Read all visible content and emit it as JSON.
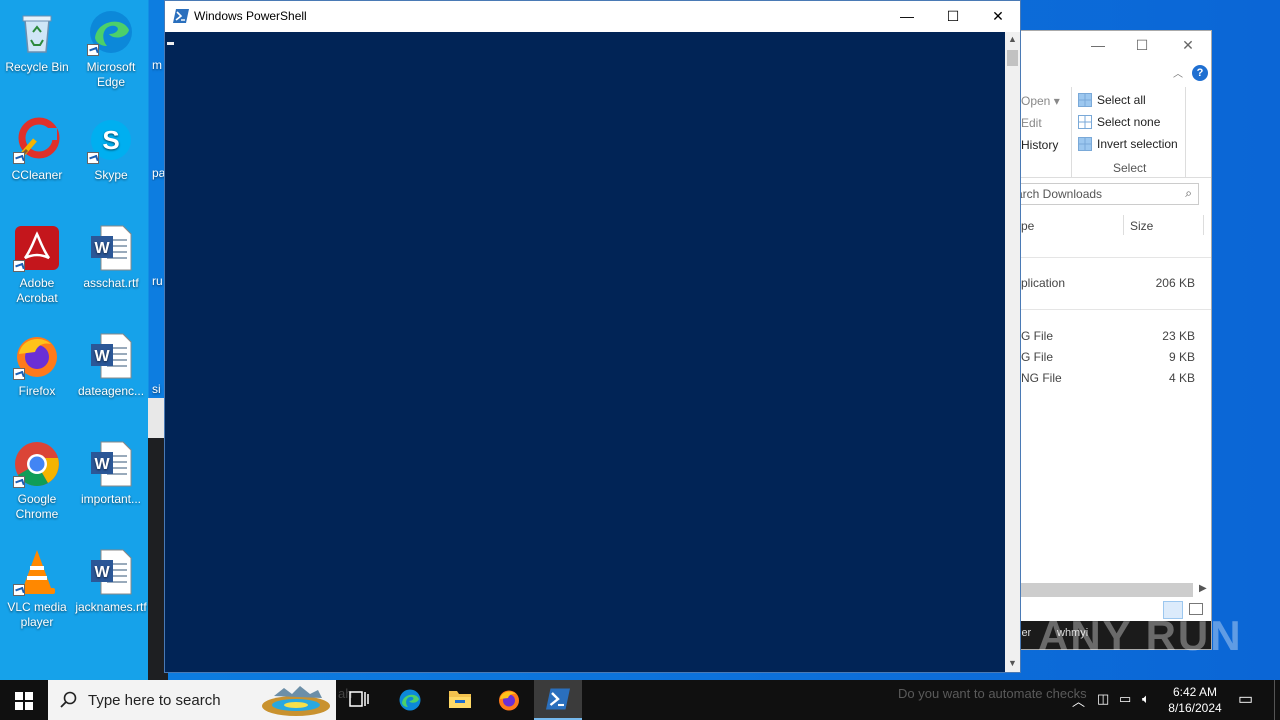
{
  "desktop": {
    "icons": [
      {
        "label": "Recycle Bin"
      },
      {
        "label": "Microsoft Edge"
      },
      {
        "label": "CCleaner"
      },
      {
        "label": "Skype"
      },
      {
        "label": "Adobe Acrobat"
      },
      {
        "label": "asschat.rtf"
      },
      {
        "label": "Firefox"
      },
      {
        "label": "dateagenc..."
      },
      {
        "label": "Google Chrome"
      },
      {
        "label": "important..."
      },
      {
        "label": "VLC media player"
      },
      {
        "label": "jacknames.rtf"
      }
    ],
    "partial_labels": [
      "m",
      "pa",
      "ru",
      "si"
    ]
  },
  "explorer": {
    "controls": {
      "minimize": "—",
      "maximize": "☐",
      "close": "✕"
    },
    "ribbon": {
      "open": "Open",
      "edit": "Edit",
      "history": "History",
      "select_all": "Select all",
      "select_none": "Select none",
      "invert_selection": "Invert selection",
      "group_label": "Select"
    },
    "search_placeholder": "arch Downloads",
    "columns": {
      "type": "pe",
      "size": "Size"
    },
    "files": [
      {
        "type": "plication",
        "size": "206 KB"
      },
      {
        "type": "G File",
        "size": "23 KB"
      },
      {
        "type": "G File",
        "size": "9 KB"
      },
      {
        "type": "NG File",
        "size": "4 KB"
      }
    ],
    "status_fragments": [
      "ler",
      "whmyi"
    ]
  },
  "powershell": {
    "title": "Windows PowerShell",
    "controls": {
      "minimize": "—",
      "maximize": "☐",
      "close": "✕"
    }
  },
  "watermark": "ANY RUN",
  "taskbar": {
    "search_placeholder": "Type here to search",
    "background_text": "Do you want to automate checks",
    "clock_time": "6:42 AM",
    "clock_date": "8/16/2024"
  },
  "colors": {
    "console_bg": "#012456",
    "desktop_blue": "#0b66d6",
    "taskbar_bg": "#101010",
    "accent": "#76b9ed"
  }
}
